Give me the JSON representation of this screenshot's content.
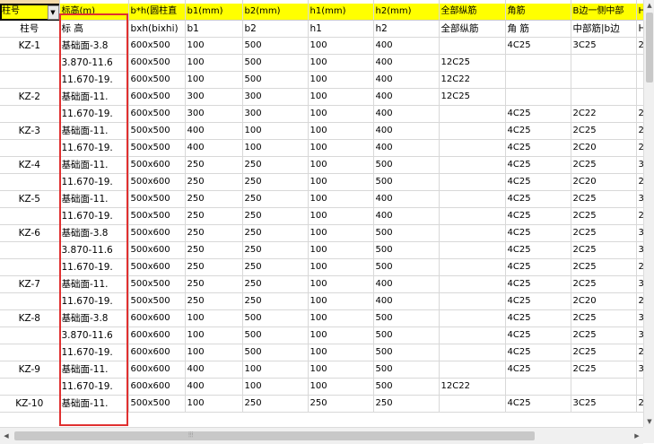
{
  "header": [
    "柱号",
    "标高(m)",
    "b*h(圆柱直",
    "b1(mm)",
    "b2(mm)",
    "h1(mm)",
    "h2(mm)",
    "全部纵筋",
    "角筋",
    "B边一侧中部",
    "H"
  ],
  "subheader": [
    "柱号",
    "标 高",
    "bxh(bixhi)",
    "b1",
    "b2",
    "h1",
    "h2",
    "全部纵筋",
    "角 筋",
    "中部筋|b边",
    "H"
  ],
  "rows": [
    [
      "KZ-1",
      "基础面-3.8",
      "600x500",
      "100",
      "500",
      "100",
      "400",
      "",
      "4C25",
      "3C25",
      "2("
    ],
    [
      "",
      "3.870-11.6",
      "600x500",
      "100",
      "500",
      "100",
      "400",
      "12C25",
      "",
      "",
      ""
    ],
    [
      "",
      "11.670-19.",
      "600x500",
      "100",
      "500",
      "100",
      "400",
      "12C22",
      "",
      "",
      ""
    ],
    [
      "KZ-2",
      "基础面-11.",
      "600x500",
      "300",
      "300",
      "100",
      "400",
      "12C25",
      "",
      "",
      ""
    ],
    [
      "",
      "11.670-19.",
      "600x500",
      "300",
      "300",
      "100",
      "400",
      "",
      "4C25",
      "2C22",
      "2("
    ],
    [
      "KZ-3",
      "基础面-11.",
      "500x500",
      "400",
      "100",
      "100",
      "400",
      "",
      "4C25",
      "2C25",
      "2("
    ],
    [
      "",
      "11.670-19.",
      "500x500",
      "400",
      "100",
      "100",
      "400",
      "",
      "4C25",
      "2C20",
      "2("
    ],
    [
      "KZ-4",
      "基础面-11.",
      "500x600",
      "250",
      "250",
      "100",
      "500",
      "",
      "4C25",
      "2C25",
      "3("
    ],
    [
      "",
      "11.670-19.",
      "500x600",
      "250",
      "250",
      "100",
      "500",
      "",
      "4C25",
      "2C20",
      "2("
    ],
    [
      "KZ-5",
      "基础面-11.",
      "500x500",
      "250",
      "250",
      "100",
      "400",
      "",
      "4C25",
      "2C25",
      "3("
    ],
    [
      "",
      "11.670-19.",
      "500x500",
      "250",
      "250",
      "100",
      "400",
      "",
      "4C25",
      "2C25",
      "2("
    ],
    [
      "KZ-6",
      "基础面-3.8",
      "500x600",
      "250",
      "250",
      "100",
      "500",
      "",
      "4C25",
      "2C25",
      "3("
    ],
    [
      "",
      "3.870-11.6",
      "500x600",
      "250",
      "250",
      "100",
      "500",
      "",
      "4C25",
      "2C25",
      "3("
    ],
    [
      "",
      "11.670-19.",
      "500x600",
      "250",
      "250",
      "100",
      "500",
      "",
      "4C25",
      "2C25",
      "2("
    ],
    [
      "KZ-7",
      "基础面-11.",
      "500x500",
      "250",
      "250",
      "100",
      "400",
      "",
      "4C25",
      "2C25",
      "3("
    ],
    [
      "",
      "11.670-19.",
      "500x500",
      "250",
      "250",
      "100",
      "400",
      "",
      "4C25",
      "2C20",
      "2("
    ],
    [
      "KZ-8",
      "基础面-3.8",
      "600x600",
      "100",
      "500",
      "100",
      "500",
      "",
      "4C25",
      "2C25",
      "3("
    ],
    [
      "",
      "3.870-11.6",
      "600x600",
      "100",
      "500",
      "100",
      "500",
      "",
      "4C25",
      "2C25",
      "3("
    ],
    [
      "",
      "11.670-19.",
      "600x600",
      "100",
      "500",
      "100",
      "500",
      "",
      "4C25",
      "2C25",
      "2("
    ],
    [
      "KZ-9",
      "基础面-11.",
      "600x600",
      "400",
      "100",
      "100",
      "500",
      "",
      "4C25",
      "2C25",
      "3("
    ],
    [
      "",
      "11.670-19.",
      "600x600",
      "400",
      "100",
      "100",
      "500",
      "12C22",
      "",
      "",
      ""
    ],
    [
      "KZ-10",
      "基础面-11.",
      "500x500",
      "100",
      "250",
      "250",
      "250",
      "",
      "4C25",
      "3C25",
      "2("
    ]
  ],
  "icons": {
    "dropdown": "chevron-down-icon",
    "scroll_up": "arrow-up-icon",
    "scroll_down": "arrow-down-icon",
    "scroll_left": "arrow-left-icon",
    "scroll_right": "arrow-right-icon"
  },
  "colors": {
    "header_bg": "#ffff00",
    "highlight": "#e03030"
  }
}
